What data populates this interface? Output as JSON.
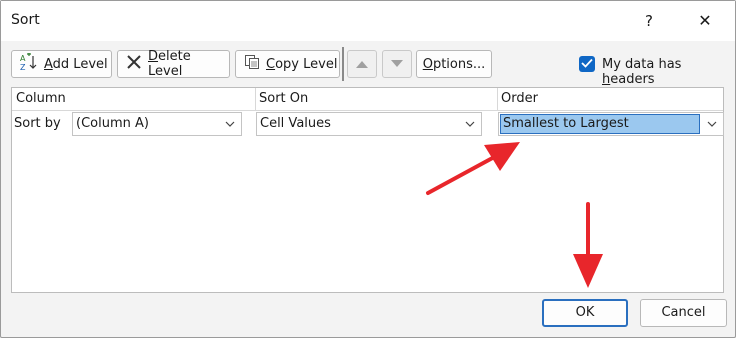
{
  "window": {
    "title": "Sort",
    "help": "?",
    "close": "✕"
  },
  "toolbar": {
    "add_level": {
      "hot": "A",
      "rest": "dd Level"
    },
    "delete_level": {
      "hot": "D",
      "rest": "elete Level"
    },
    "copy_level": {
      "hot": "C",
      "rest": "opy Level"
    },
    "options": {
      "hot": "O",
      "rest": "ptions..."
    },
    "headers_checkbox": {
      "checked": true,
      "prefix": "My data has ",
      "hot": "h",
      "rest": "eaders"
    }
  },
  "grid": {
    "headers": [
      "Column",
      "Sort On",
      "Order"
    ],
    "row": {
      "label": "Sort by",
      "column": "(Column A)",
      "sort_on": "Cell Values",
      "order": "Smallest to Largest"
    }
  },
  "footer": {
    "ok": "OK",
    "cancel": "Cancel"
  },
  "colors": {
    "accent": "#0f67c5",
    "selection": "#9bc8ef",
    "annotation_arrow": "#e8262b"
  }
}
